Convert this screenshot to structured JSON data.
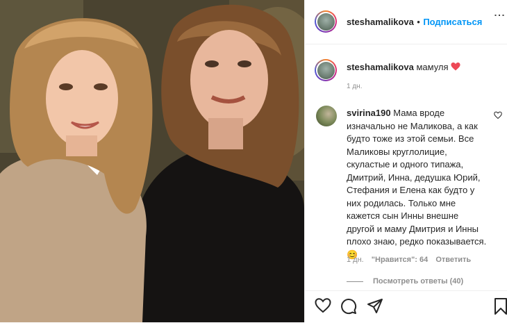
{
  "post": {
    "username": "steshamalikova",
    "follow_label": "Подписаться",
    "dot": "•",
    "caption": "мамуля",
    "caption_time": "1 дн."
  },
  "comment": {
    "username": "svirina190",
    "text": "Мама вроде изначально не Маликова, а как будто тоже из этой семьи. Все Маликовы круглолицие, скуластые и одного типажа, Дмитрий, Инна, дедушка Юрий, Стефания и Елена как будто у них родилась. Только мне кажется сын Инны внешне другой и маму Дмитрия и Инны плохо знаю, редко показывается.",
    "emoji": "😊",
    "time": "1 дн.",
    "likes": "\"Нравится\": 64",
    "reply": "Ответить",
    "view_replies": "Посмотреть ответы (40)"
  },
  "icons": {
    "like": "heart-icon",
    "comment": "comment-icon",
    "share": "paper-plane-icon",
    "save": "bookmark-icon",
    "options": "more-options-icon",
    "caption_heart": "red-heart-emoji",
    "comment_like": "small-heart-icon"
  },
  "colors": {
    "accent": "#0095f6",
    "text": "#262626",
    "muted": "#8e8e8e",
    "heart": "#ed4956"
  }
}
